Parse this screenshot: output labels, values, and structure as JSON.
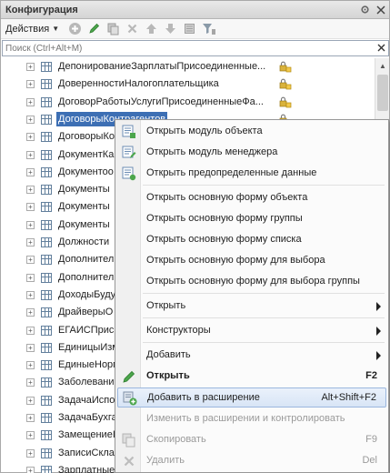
{
  "panel": {
    "title": "Конфигурация",
    "title_buttons": [
      "gear-icon",
      "close-icon"
    ]
  },
  "toolbar": {
    "actions_label": "Действия",
    "icons": [
      "add-icon",
      "edit-icon",
      "copy-icon",
      "delete-icon",
      "move-up-icon",
      "move-down-icon",
      "properties-icon",
      "filter-icon"
    ]
  },
  "search": {
    "placeholder": "Поиск (Ctrl+Alt+M)"
  },
  "tree": {
    "items": [
      {
        "label": "ДепонированиеЗарплатыПрисоединенные...",
        "locked": true,
        "selected": false
      },
      {
        "label": "ДоверенностиНалогоплательщика",
        "locked": true,
        "selected": false
      },
      {
        "label": "ДоговорРаботыУслугиПрисоединенныеФа...",
        "locked": true,
        "selected": false
      },
      {
        "label": "ДоговорыКонтрагентов",
        "locked": true,
        "selected": true
      },
      {
        "label": "ДоговорыКо",
        "locked": false,
        "selected": false
      },
      {
        "label": "ДокументКа",
        "locked": false,
        "selected": false
      },
      {
        "label": "Документоо",
        "locked": false,
        "selected": false
      },
      {
        "label": "Документы",
        "locked": false,
        "selected": false
      },
      {
        "label": "Документы",
        "locked": false,
        "selected": false
      },
      {
        "label": "Документы",
        "locked": false,
        "selected": false
      },
      {
        "label": "Должности",
        "locked": false,
        "selected": false
      },
      {
        "label": "Дополнител",
        "locked": false,
        "selected": false
      },
      {
        "label": "Дополнител",
        "locked": false,
        "selected": false
      },
      {
        "label": "ДоходыБуду",
        "locked": false,
        "selected": false
      },
      {
        "label": "ДрайверыО",
        "locked": false,
        "selected": false
      },
      {
        "label": "ЕГАИСПрисо",
        "locked": false,
        "selected": false
      },
      {
        "label": "ЕдиницыИзм",
        "locked": false,
        "selected": false
      },
      {
        "label": "ЕдиныеНорм",
        "locked": false,
        "selected": false
      },
      {
        "label": "Заболевани",
        "locked": false,
        "selected": false
      },
      {
        "label": "ЗадачаИспо",
        "locked": false,
        "selected": false
      },
      {
        "label": "ЗадачаБухга",
        "locked": false,
        "selected": false
      },
      {
        "label": "ЗамещениеI",
        "locked": false,
        "selected": false
      },
      {
        "label": "ЗаписиСкла",
        "locked": false,
        "selected": false
      },
      {
        "label": "Зарплатные",
        "locked": false,
        "selected": false
      }
    ]
  },
  "context_menu": {
    "items": [
      {
        "label": "Открыть модуль объекта",
        "shortcut": "",
        "icon": "module-object-icon",
        "submenu": false,
        "bold": false,
        "disabled": false,
        "highlighted": false
      },
      {
        "label": "Открыть модуль менеджера",
        "shortcut": "",
        "icon": "module-manager-icon",
        "submenu": false,
        "bold": false,
        "disabled": false,
        "highlighted": false
      },
      {
        "label": "Открыть предопределенные данные",
        "shortcut": "",
        "icon": "predefined-data-icon",
        "submenu": false,
        "bold": false,
        "disabled": false,
        "highlighted": false
      },
      {
        "label": "Открыть основную форму объекта",
        "shortcut": "",
        "icon": "",
        "submenu": false,
        "bold": false,
        "disabled": false,
        "highlighted": false
      },
      {
        "label": "Открыть основную форму группы",
        "shortcut": "",
        "icon": "",
        "submenu": false,
        "bold": false,
        "disabled": false,
        "highlighted": false
      },
      {
        "label": "Открыть основную форму списка",
        "shortcut": "",
        "icon": "",
        "submenu": false,
        "bold": false,
        "disabled": false,
        "highlighted": false
      },
      {
        "label": "Открыть основную форму для выбора",
        "shortcut": "",
        "icon": "",
        "submenu": false,
        "bold": false,
        "disabled": false,
        "highlighted": false
      },
      {
        "label": "Открыть основную форму для выбора группы",
        "shortcut": "",
        "icon": "",
        "submenu": false,
        "bold": false,
        "disabled": false,
        "highlighted": false
      },
      {
        "label": "Открыть",
        "shortcut": "",
        "icon": "",
        "submenu": true,
        "bold": false,
        "disabled": false,
        "highlighted": false
      },
      {
        "label": "Конструкторы",
        "shortcut": "",
        "icon": "",
        "submenu": true,
        "bold": false,
        "disabled": false,
        "highlighted": false
      },
      {
        "label": "Добавить",
        "shortcut": "",
        "icon": "",
        "submenu": true,
        "bold": false,
        "disabled": false,
        "highlighted": false
      },
      {
        "label": "Открыть",
        "shortcut": "F2",
        "icon": "pencil-icon",
        "submenu": false,
        "bold": true,
        "disabled": false,
        "highlighted": false
      },
      {
        "label": "Добавить в расширение",
        "shortcut": "Alt+Shift+F2",
        "icon": "add-to-extension-icon",
        "submenu": false,
        "bold": false,
        "disabled": false,
        "highlighted": true
      },
      {
        "label": "Изменить в расширении и контролировать",
        "shortcut": "",
        "icon": "",
        "submenu": false,
        "bold": false,
        "disabled": true,
        "highlighted": false
      },
      {
        "label": "Скопировать",
        "shortcut": "F9",
        "icon": "copy-icon",
        "submenu": false,
        "bold": false,
        "disabled": true,
        "highlighted": false
      },
      {
        "label": "Удалить",
        "shortcut": "Del",
        "icon": "delete-icon",
        "submenu": false,
        "bold": false,
        "disabled": true,
        "highlighted": false
      }
    ]
  },
  "colors": {
    "selection": "#3d6fb4",
    "menu_highlight": "#d8e5f6",
    "toolbar_green": "#4ca64c",
    "toolbar_disabled": "#b8b8b8"
  }
}
